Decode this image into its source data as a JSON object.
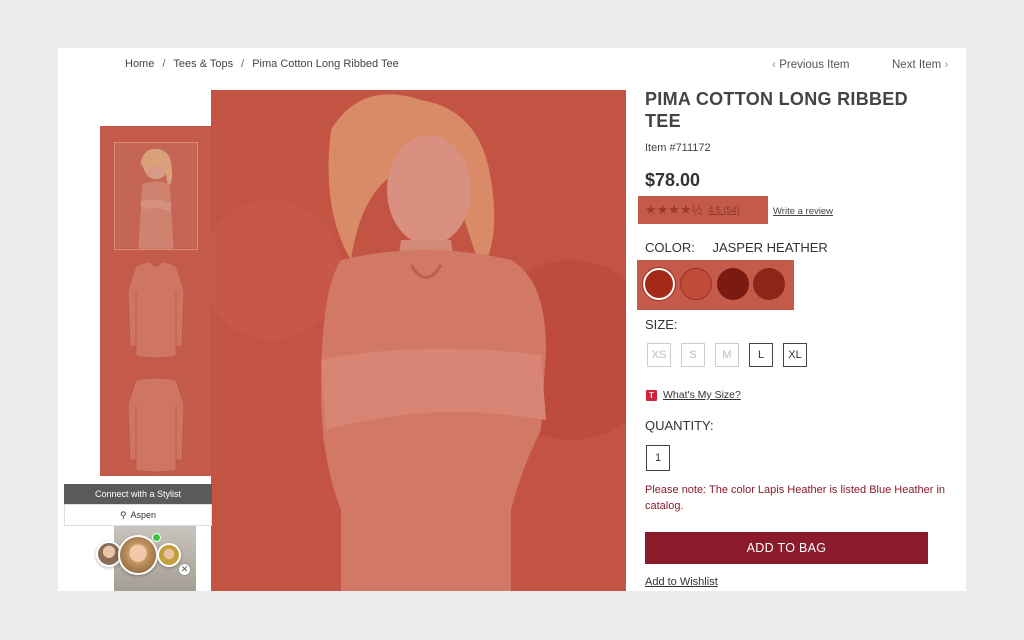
{
  "breadcrumb": {
    "home": "Home",
    "sep1": "/",
    "category": "Tees & Tops",
    "sep2": "/",
    "current": "Pima Cotton Long Ribbed Tee"
  },
  "nav": {
    "prev_chevron": "‹",
    "prev_label": "Previous Item",
    "next_label": "Next Item",
    "next_chevron": "›"
  },
  "product": {
    "title": "PIMA COTTON LONG RIBBED TEE",
    "item_number": "Item #711172",
    "price": "$78.00",
    "stars": "★★★★½",
    "rating_text": "4.5 (54)",
    "rating_value": 4.5,
    "write_review": "Write a review",
    "color_label": "COLOR:",
    "color_value": "JASPER HEATHER",
    "swatches": [
      "#a32a18",
      "#c14a38",
      "#7a1a10",
      "#8c2618"
    ],
    "size_label": "SIZE:",
    "sizes": [
      "XS",
      "S",
      "M",
      "L",
      "XL"
    ],
    "whats_my_size_icon": "T",
    "whats_my_size": "What's My Size?",
    "quantity_label": "QUANTITY:",
    "quantity_value": "1",
    "note": "Please note: The color Lapis Heather is listed Blue Heather in catalog.",
    "add_to_bag": "ADD TO BAG",
    "add_to_wishlist": "Add to Wishlist"
  },
  "stylist": {
    "connect_label": "Connect with a Stylist",
    "location": "Aspen",
    "close_glyph": "✕",
    "pin_icon": "map-pin-icon"
  },
  "colors": {
    "accent": "#8b1a2b",
    "note": "#8a1a2a",
    "overlay": "#c45a4a"
  }
}
